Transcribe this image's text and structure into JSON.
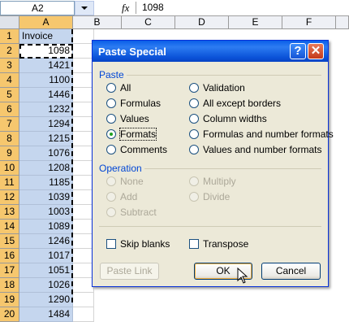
{
  "formula_bar": {
    "name_box": "A2",
    "fx": "fx",
    "value": "1098"
  },
  "columns": [
    "A",
    "B",
    "C",
    "D",
    "E",
    "F"
  ],
  "rows": [
    {
      "num": "1",
      "a": "Invoice"
    },
    {
      "num": "2",
      "a": "1098"
    },
    {
      "num": "3",
      "a": "1421"
    },
    {
      "num": "4",
      "a": "1100"
    },
    {
      "num": "5",
      "a": "1446"
    },
    {
      "num": "6",
      "a": "1232"
    },
    {
      "num": "7",
      "a": "1294"
    },
    {
      "num": "8",
      "a": "1215"
    },
    {
      "num": "9",
      "a": "1076"
    },
    {
      "num": "10",
      "a": "1208"
    },
    {
      "num": "11",
      "a": "1185"
    },
    {
      "num": "12",
      "a": "1039"
    },
    {
      "num": "13",
      "a": "1003"
    },
    {
      "num": "14",
      "a": "1089"
    },
    {
      "num": "15",
      "a": "1246"
    },
    {
      "num": "16",
      "a": "1017"
    },
    {
      "num": "17",
      "a": "1051"
    },
    {
      "num": "18",
      "a": "1026"
    },
    {
      "num": "19",
      "a": "1290"
    },
    {
      "num": "20",
      "a": "1484"
    }
  ],
  "dialog": {
    "title": "Paste Special",
    "help": "?",
    "close": "✕",
    "paste_label": "Paste",
    "paste_options": {
      "all": "All",
      "formulas": "Formulas",
      "values": "Values",
      "formats": "Formats",
      "comments": "Comments",
      "validation": "Validation",
      "all_except_borders": "All except borders",
      "column_widths": "Column widths",
      "formulas_number_formats": "Formulas and number formats",
      "values_number_formats": "Values and number formats"
    },
    "selected_paste": "Formats",
    "operation_label": "Operation",
    "operation_options": {
      "none": "None",
      "add": "Add",
      "subtract": "Subtract",
      "multiply": "Multiply",
      "divide": "Divide"
    },
    "skip_blanks": "Skip blanks",
    "transpose": "Transpose",
    "paste_link": "Paste Link",
    "ok": "OK",
    "cancel": "Cancel"
  },
  "colors": {
    "titlebar": "#0a52d8",
    "selected_column": "#c5d6ee",
    "header_highlight": "#f6c76e"
  }
}
